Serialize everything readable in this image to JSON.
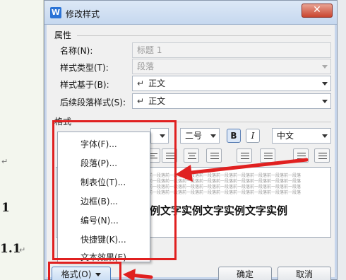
{
  "background_doc": {
    "mark_1": "↵",
    "heading_1": "1",
    "heading_2": "1.1",
    "mark_2": "↵"
  },
  "dialog": {
    "title": "修改样式",
    "app_icon": "W",
    "close_glyph": "✕"
  },
  "properties": {
    "section_label": "属性",
    "name_label": "名称(N):",
    "name_value": "标题 1",
    "style_type_label": "样式类型(T):",
    "style_type_value": "段落",
    "based_on_label": "样式基于(B):",
    "based_on_value": "正文",
    "next_style_label": "后续段落样式(S):",
    "next_style_value": "正文",
    "para_glyph": "↵"
  },
  "format": {
    "section_label": "格式",
    "font_size_value": "二号",
    "bold_label": "B",
    "italic_label": "I",
    "script_value": "中文"
  },
  "preview": {
    "small_text": "前一段落前一段落前一段落前一段落前一段落前一段落前一段落前一段落前一段落",
    "big_text": "例文字实例文字实例文字实例"
  },
  "menu": {
    "items": [
      "字体(F)...",
      "段落(P)...",
      "制表位(T)...",
      "边框(B)...",
      "编号(N)...",
      "快捷键(K)...",
      "文本效果(E)..."
    ]
  },
  "buttons": {
    "format_label": "格式(O)",
    "ok_label": "确定",
    "cancel_label": "取消"
  },
  "colors": {
    "annotation_red": "#e02020",
    "title_bar": "#c6d8ef",
    "accent_blue": "#2b73d6"
  }
}
